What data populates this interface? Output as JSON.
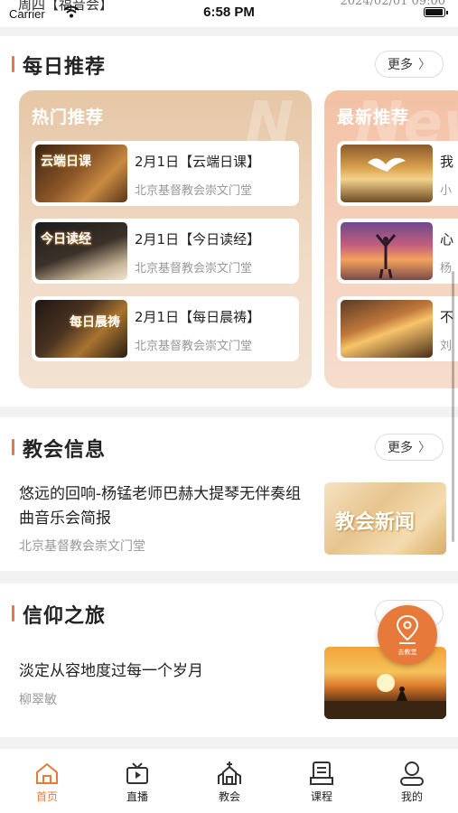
{
  "status_bar": {
    "behind_left": "周四【福音会】",
    "behind_right": "2024/02/01 09:00",
    "carrier": "Carrier",
    "time": "6:58 PM"
  },
  "daily": {
    "title": "每日推荐",
    "more_label": "更多",
    "hot": {
      "title": "热门推荐",
      "items": [
        {
          "title": "2月1日【云端日课】",
          "subtitle": "北京基督教会崇文门堂",
          "thumb_text": "云端日课"
        },
        {
          "title": "2月1日【今日读经】",
          "subtitle": "北京基督教会崇文门堂",
          "thumb_text": "今日读经"
        },
        {
          "title": "2月1日【每日晨祷】",
          "subtitle": "北京基督教会崇文门堂",
          "thumb_text": "每日晨祷"
        }
      ]
    },
    "latest": {
      "title": "最新推荐",
      "items": [
        {
          "title": "我",
          "subtitle": "小"
        },
        {
          "title": "心",
          "subtitle": "杨"
        },
        {
          "title": "不",
          "subtitle": "刘"
        }
      ]
    }
  },
  "church_info": {
    "title": "教会信息",
    "more_label": "更多",
    "item": {
      "title": "悠远的回响-杨锰老师巴赫大提琴无伴奏组曲音乐会简报",
      "subtitle": "北京基督教会崇文门堂",
      "image_text": "教会新闻"
    }
  },
  "faith_journey": {
    "title": "信仰之旅",
    "item": {
      "title": "淡定从容地度过每一个岁月",
      "subtitle": "柳翠敏"
    }
  },
  "fab": {
    "label": "去教堂",
    "icon": "location-pin-icon",
    "color": "#e77a3a"
  },
  "tabs": [
    {
      "label": "首页",
      "icon": "home-icon",
      "active": true
    },
    {
      "label": "直播",
      "icon": "tv-icon",
      "active": false
    },
    {
      "label": "教会",
      "icon": "church-icon",
      "active": false
    },
    {
      "label": "课程",
      "icon": "course-icon",
      "active": false
    },
    {
      "label": "我的",
      "icon": "profile-icon",
      "active": false
    }
  ],
  "colors": {
    "accent": "#e77a3a",
    "hot_card": "#e6c7a6",
    "latest_card": "#f3c1a4"
  }
}
